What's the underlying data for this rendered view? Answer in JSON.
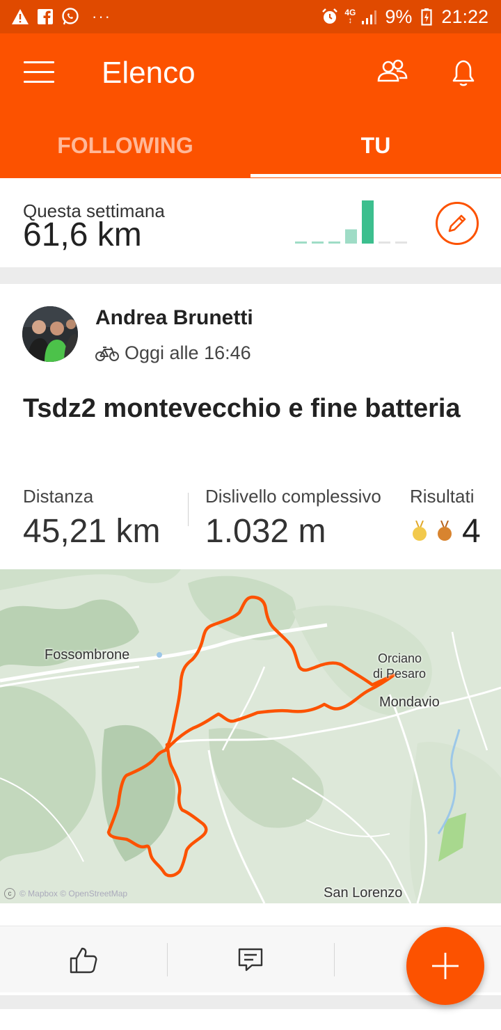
{
  "status_bar": {
    "icons_left": [
      "warning-icon",
      "facebook-icon",
      "whatsapp-icon",
      "more-dots-icon"
    ],
    "dots": "···",
    "network_top": "4G",
    "network_bottom": "↕",
    "battery": "9%",
    "time": "21:22"
  },
  "app_bar": {
    "title": "Elenco",
    "tabs": [
      {
        "label": "FOLLOWING",
        "selected": false
      },
      {
        "label": "TU",
        "selected": true
      }
    ],
    "colors": {
      "brand": "#fc5200",
      "status": "#e04a00"
    }
  },
  "weekly": {
    "label": "Questa settimana",
    "value": "61,6 km",
    "bars_fraction": [
      0,
      0,
      0,
      0.33,
      1.0,
      0,
      0
    ],
    "bar_colors": {
      "past": "#9fdcc6",
      "today": "#3cbf8e",
      "future": "#e3e3e3"
    }
  },
  "activity": {
    "athlete": "Andrea Brunetti",
    "sport_icon": "bike-icon",
    "time": "Oggi alle 16:46",
    "title": "Tsdz2 montevecchio e fine batteria",
    "stats": {
      "distance_label": "Distanza",
      "distance_value": "45,21 km",
      "elevation_label": "Dislivello complessivo",
      "elevation_value": "1.032 m",
      "results_label": "Risultati",
      "results_count": "4",
      "medals": [
        "gold-medal-icon",
        "bronze-medal-icon"
      ]
    },
    "map": {
      "places": [
        "Fossombrone",
        "Orciano",
        "di Pesaro",
        "Mondavio",
        "San Lorenzo"
      ],
      "attribution": "© Mapbox © OpenStreetMap",
      "route_color": "#fc5200"
    }
  },
  "actions": {
    "icons": [
      "thumbs-up-icon",
      "comment-icon",
      "share-icon"
    ]
  },
  "fab": {
    "icon": "plus-icon"
  }
}
